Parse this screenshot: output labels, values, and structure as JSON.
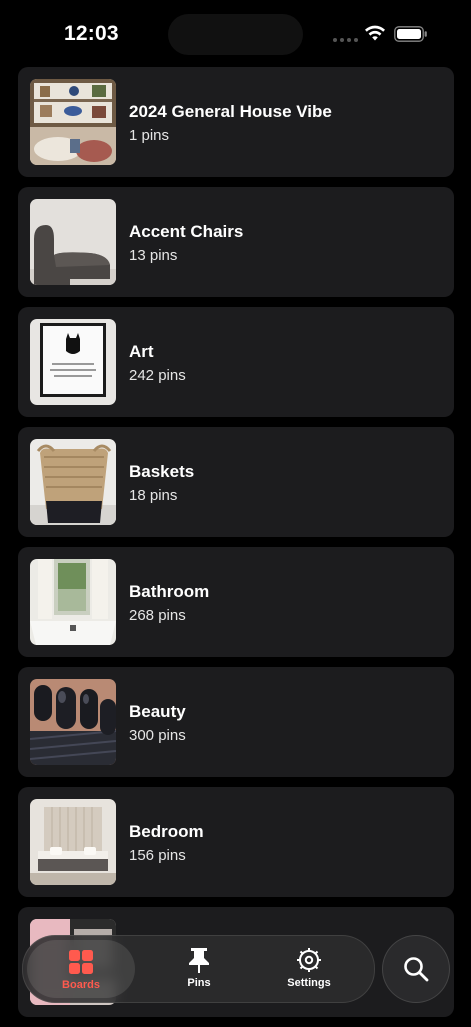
{
  "status_bar": {
    "time": "12:03"
  },
  "boards": [
    {
      "title": "2024 General House Vibe",
      "count": "1 pins",
      "thumb": "living-room-shelf"
    },
    {
      "title": "Accent Chairs",
      "count": "13 pins",
      "thumb": "boucle-chair"
    },
    {
      "title": "Art",
      "count": "242 pins",
      "thumb": "batman-print"
    },
    {
      "title": "Baskets",
      "count": "18 pins",
      "thumb": "woven-basket"
    },
    {
      "title": "Bathroom",
      "count": "268 pins",
      "thumb": "bathtub-window"
    },
    {
      "title": "Beauty",
      "count": "300 pins",
      "thumb": "black-nails"
    },
    {
      "title": "Bedroom",
      "count": "156 pins",
      "thumb": "neutral-bedroom"
    },
    {
      "title": "",
      "count": "",
      "thumb": "partial-board"
    }
  ],
  "tabbar": {
    "tabs": [
      {
        "label": "Boards",
        "icon": "boards-grid-icon",
        "active": true
      },
      {
        "label": "Pins",
        "icon": "pushpin-icon",
        "active": false
      },
      {
        "label": "Settings",
        "icon": "gear-icon",
        "active": false
      }
    ],
    "accent_color": "#ff5a4e"
  },
  "search": {
    "icon": "search-icon"
  }
}
